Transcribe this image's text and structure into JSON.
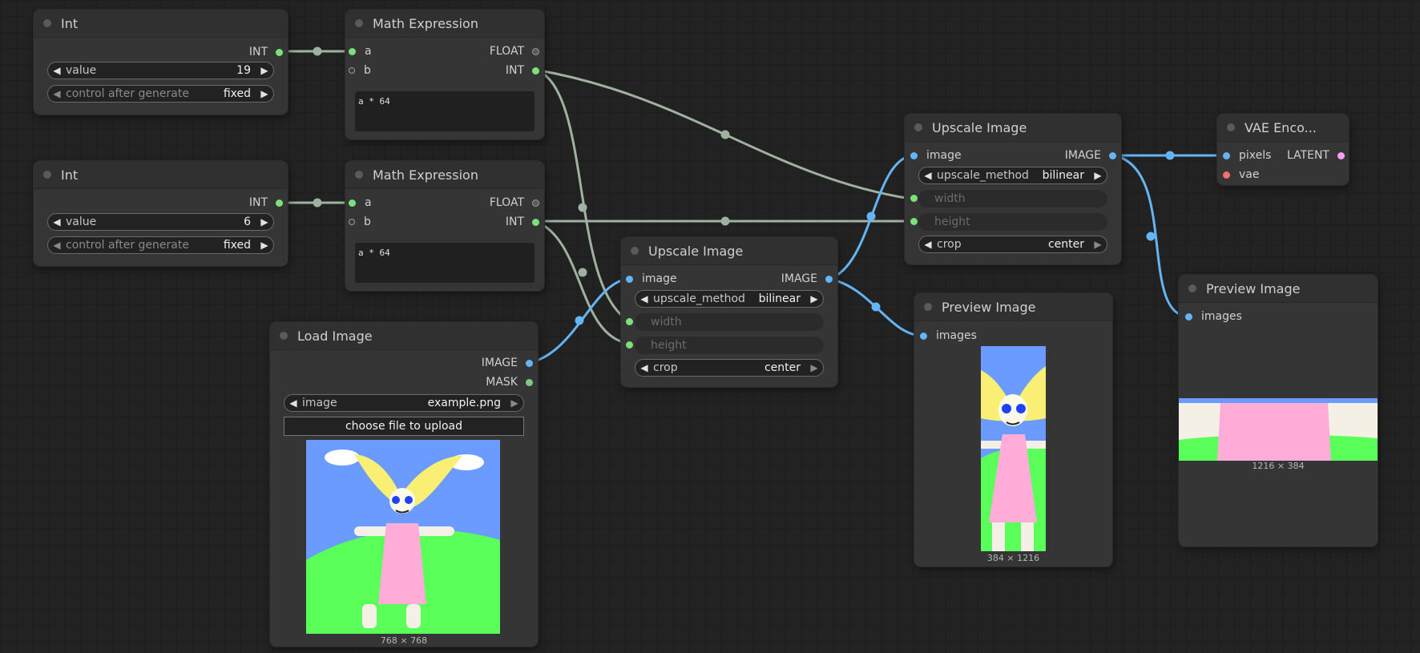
{
  "nodes": {
    "int1": {
      "title": "Int",
      "out": "INT",
      "w_value_label": "value",
      "w_value": "19",
      "w_ctrl_label": "control after generate",
      "w_ctrl": "fixed"
    },
    "int2": {
      "title": "Int",
      "out": "INT",
      "w_value_label": "value",
      "w_value": "6",
      "w_ctrl_label": "control after generate",
      "w_ctrl": "fixed"
    },
    "math1": {
      "title": "Math Expression",
      "in_a": "a",
      "in_b": "b",
      "out_float": "FLOAT",
      "out_int": "INT",
      "expr": "a * 64"
    },
    "math2": {
      "title": "Math Expression",
      "in_a": "a",
      "in_b": "b",
      "out_float": "FLOAT",
      "out_int": "INT",
      "expr": "a * 64"
    },
    "load": {
      "title": "Load Image",
      "out_image": "IMAGE",
      "out_mask": "MASK",
      "w_image_label": "image",
      "w_image": "example.png",
      "upload": "choose file to upload",
      "dims": "768 × 768"
    },
    "up1": {
      "title": "Upscale Image",
      "in_image": "image",
      "out_image": "IMAGE",
      "w_method_label": "upscale_method",
      "w_method": "bilinear",
      "w_width": "width",
      "w_height": "height",
      "w_crop_label": "crop",
      "w_crop": "center"
    },
    "up2": {
      "title": "Upscale Image",
      "in_image": "image",
      "out_image": "IMAGE",
      "w_method_label": "upscale_method",
      "w_method": "bilinear",
      "w_width": "width",
      "w_height": "height",
      "w_crop_label": "crop",
      "w_crop": "center"
    },
    "prev1": {
      "title": "Preview Image",
      "in_images": "images",
      "dims": "384 × 1216"
    },
    "prev2": {
      "title": "Preview Image",
      "in_images": "images",
      "dims": "1216 × 384"
    },
    "vae": {
      "title": "VAE Enco...",
      "in_pixels": "pixels",
      "in_vae": "vae",
      "out_latent": "LATENT"
    }
  },
  "colors": {
    "canvas": "#222222",
    "node_body": "#353535",
    "node_title": "#303030",
    "int_link": "#9fb19f",
    "image_link": "#64b5f6",
    "latent": "#ff9cf9",
    "vae": "#ff6e6e"
  }
}
